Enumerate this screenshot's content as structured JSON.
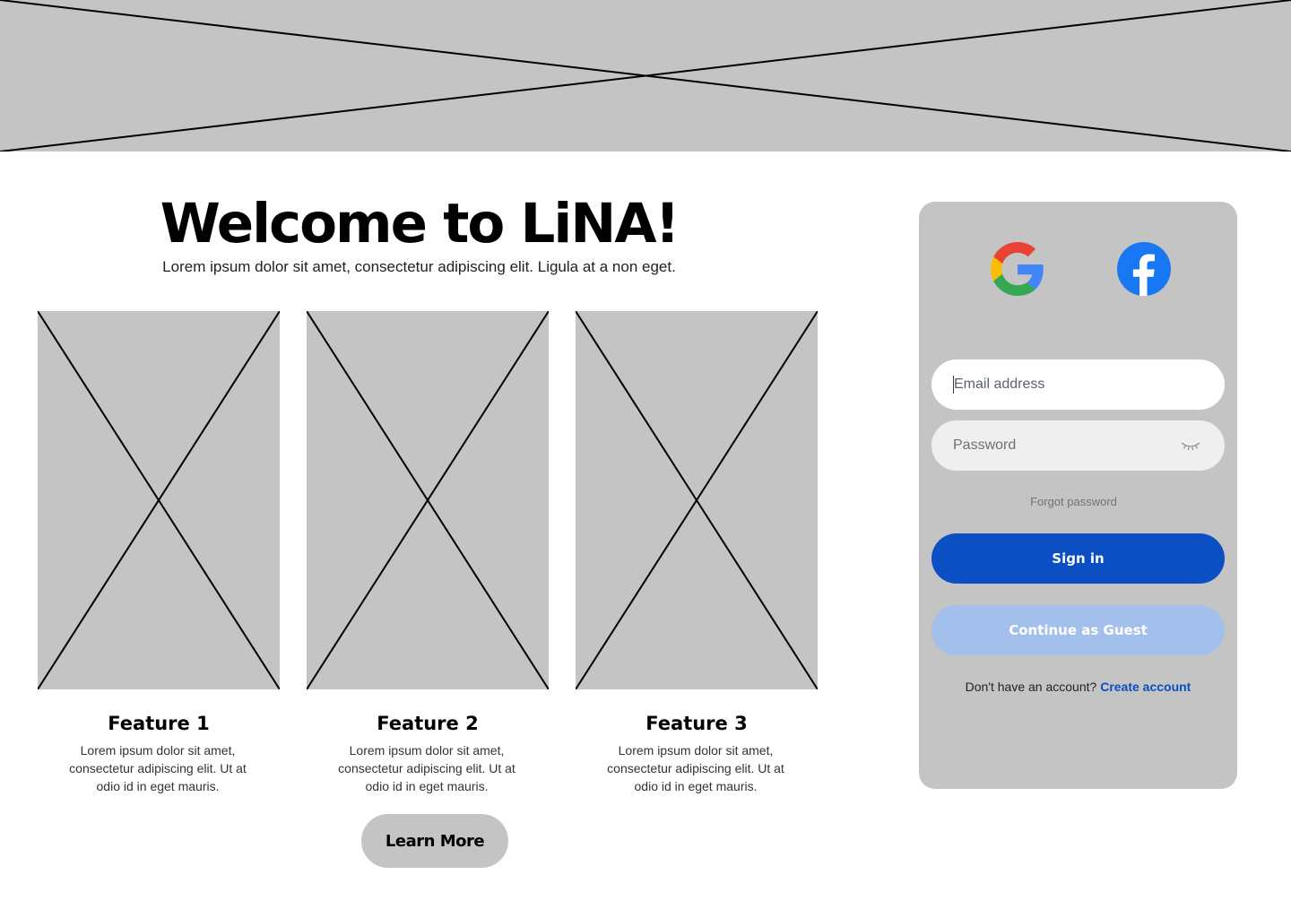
{
  "hero": {
    "image": "placeholder-image"
  },
  "welcome": {
    "title": "Welcome to LiNA!",
    "subtitle": "Lorem ipsum dolor sit amet, consectetur adipiscing elit. Ligula at a non eget."
  },
  "features": [
    {
      "title": "Feature 1",
      "description": "Lorem ipsum dolor sit amet, consectetur adipiscing elit. Ut at odio id in eget mauris."
    },
    {
      "title": "Feature 2",
      "description": "Lorem ipsum dolor sit amet, consectetur adipiscing elit. Ut at odio id in eget mauris."
    },
    {
      "title": "Feature 3",
      "description": "Lorem ipsum dolor sit amet, consectetur adipiscing elit. Ut at odio id in eget mauris."
    }
  ],
  "learn_more_label": "Learn More",
  "login": {
    "social": {
      "google_icon": "google-icon",
      "facebook_icon": "facebook-icon"
    },
    "email_placeholder": "Email address",
    "password_placeholder": "Password",
    "password_toggle_icon": "eye-closed-icon",
    "forgot_password": "Forgot password",
    "sign_in_label": "Sign in",
    "guest_label": "Continue as Guest",
    "no_account_text": "Don't have an account?",
    "create_account_label": "Create account"
  },
  "colors": {
    "placeholder_gray": "#c4c4c4",
    "primary_blue": "#0b4fc2",
    "guest_blue": "#a3bfec",
    "google_blue": "#4285f4",
    "google_red": "#ea4335",
    "google_yellow": "#fbbc05",
    "google_green": "#34a853",
    "facebook_blue": "#1877f2"
  }
}
